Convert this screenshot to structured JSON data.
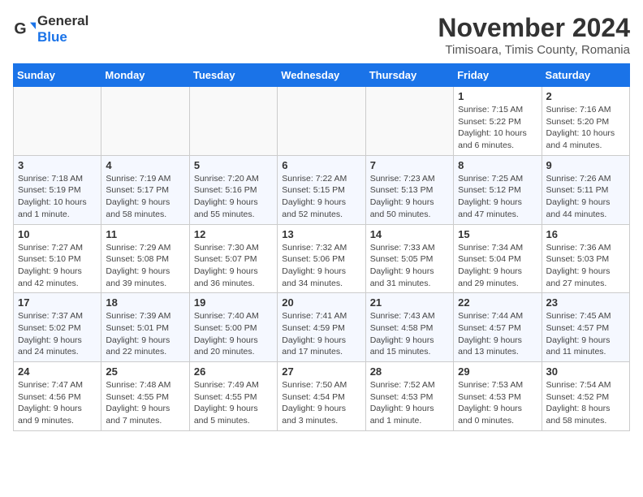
{
  "logo": {
    "text_general": "General",
    "text_blue": "Blue"
  },
  "title": "November 2024",
  "location": "Timisoara, Timis County, Romania",
  "headers": [
    "Sunday",
    "Monday",
    "Tuesday",
    "Wednesday",
    "Thursday",
    "Friday",
    "Saturday"
  ],
  "weeks": [
    [
      {
        "day": "",
        "info": ""
      },
      {
        "day": "",
        "info": ""
      },
      {
        "day": "",
        "info": ""
      },
      {
        "day": "",
        "info": ""
      },
      {
        "day": "",
        "info": ""
      },
      {
        "day": "1",
        "info": "Sunrise: 7:15 AM\nSunset: 5:22 PM\nDaylight: 10 hours and 6 minutes."
      },
      {
        "day": "2",
        "info": "Sunrise: 7:16 AM\nSunset: 5:20 PM\nDaylight: 10 hours and 4 minutes."
      }
    ],
    [
      {
        "day": "3",
        "info": "Sunrise: 7:18 AM\nSunset: 5:19 PM\nDaylight: 10 hours and 1 minute."
      },
      {
        "day": "4",
        "info": "Sunrise: 7:19 AM\nSunset: 5:17 PM\nDaylight: 9 hours and 58 minutes."
      },
      {
        "day": "5",
        "info": "Sunrise: 7:20 AM\nSunset: 5:16 PM\nDaylight: 9 hours and 55 minutes."
      },
      {
        "day": "6",
        "info": "Sunrise: 7:22 AM\nSunset: 5:15 PM\nDaylight: 9 hours and 52 minutes."
      },
      {
        "day": "7",
        "info": "Sunrise: 7:23 AM\nSunset: 5:13 PM\nDaylight: 9 hours and 50 minutes."
      },
      {
        "day": "8",
        "info": "Sunrise: 7:25 AM\nSunset: 5:12 PM\nDaylight: 9 hours and 47 minutes."
      },
      {
        "day": "9",
        "info": "Sunrise: 7:26 AM\nSunset: 5:11 PM\nDaylight: 9 hours and 44 minutes."
      }
    ],
    [
      {
        "day": "10",
        "info": "Sunrise: 7:27 AM\nSunset: 5:10 PM\nDaylight: 9 hours and 42 minutes."
      },
      {
        "day": "11",
        "info": "Sunrise: 7:29 AM\nSunset: 5:08 PM\nDaylight: 9 hours and 39 minutes."
      },
      {
        "day": "12",
        "info": "Sunrise: 7:30 AM\nSunset: 5:07 PM\nDaylight: 9 hours and 36 minutes."
      },
      {
        "day": "13",
        "info": "Sunrise: 7:32 AM\nSunset: 5:06 PM\nDaylight: 9 hours and 34 minutes."
      },
      {
        "day": "14",
        "info": "Sunrise: 7:33 AM\nSunset: 5:05 PM\nDaylight: 9 hours and 31 minutes."
      },
      {
        "day": "15",
        "info": "Sunrise: 7:34 AM\nSunset: 5:04 PM\nDaylight: 9 hours and 29 minutes."
      },
      {
        "day": "16",
        "info": "Sunrise: 7:36 AM\nSunset: 5:03 PM\nDaylight: 9 hours and 27 minutes."
      }
    ],
    [
      {
        "day": "17",
        "info": "Sunrise: 7:37 AM\nSunset: 5:02 PM\nDaylight: 9 hours and 24 minutes."
      },
      {
        "day": "18",
        "info": "Sunrise: 7:39 AM\nSunset: 5:01 PM\nDaylight: 9 hours and 22 minutes."
      },
      {
        "day": "19",
        "info": "Sunrise: 7:40 AM\nSunset: 5:00 PM\nDaylight: 9 hours and 20 minutes."
      },
      {
        "day": "20",
        "info": "Sunrise: 7:41 AM\nSunset: 4:59 PM\nDaylight: 9 hours and 17 minutes."
      },
      {
        "day": "21",
        "info": "Sunrise: 7:43 AM\nSunset: 4:58 PM\nDaylight: 9 hours and 15 minutes."
      },
      {
        "day": "22",
        "info": "Sunrise: 7:44 AM\nSunset: 4:57 PM\nDaylight: 9 hours and 13 minutes."
      },
      {
        "day": "23",
        "info": "Sunrise: 7:45 AM\nSunset: 4:57 PM\nDaylight: 9 hours and 11 minutes."
      }
    ],
    [
      {
        "day": "24",
        "info": "Sunrise: 7:47 AM\nSunset: 4:56 PM\nDaylight: 9 hours and 9 minutes."
      },
      {
        "day": "25",
        "info": "Sunrise: 7:48 AM\nSunset: 4:55 PM\nDaylight: 9 hours and 7 minutes."
      },
      {
        "day": "26",
        "info": "Sunrise: 7:49 AM\nSunset: 4:55 PM\nDaylight: 9 hours and 5 minutes."
      },
      {
        "day": "27",
        "info": "Sunrise: 7:50 AM\nSunset: 4:54 PM\nDaylight: 9 hours and 3 minutes."
      },
      {
        "day": "28",
        "info": "Sunrise: 7:52 AM\nSunset: 4:53 PM\nDaylight: 9 hours and 1 minute."
      },
      {
        "day": "29",
        "info": "Sunrise: 7:53 AM\nSunset: 4:53 PM\nDaylight: 9 hours and 0 minutes."
      },
      {
        "day": "30",
        "info": "Sunrise: 7:54 AM\nSunset: 4:52 PM\nDaylight: 8 hours and 58 minutes."
      }
    ]
  ]
}
